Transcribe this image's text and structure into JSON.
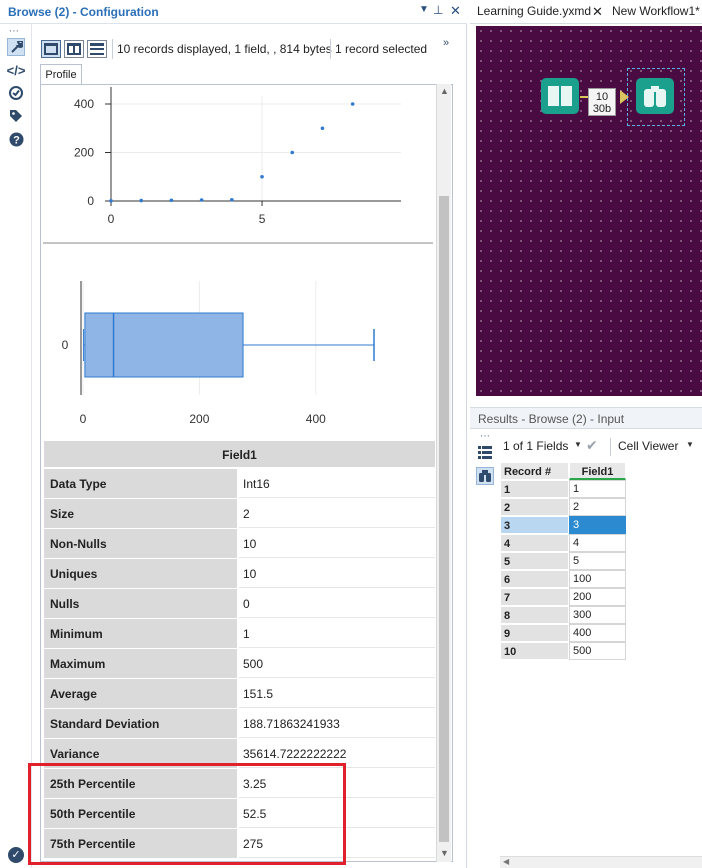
{
  "config_panel": {
    "title": "Browse (2) - Configuration",
    "status_records": "10 records displayed, 1 field, , 814 bytes",
    "status_selected": "1 record selected",
    "tab_profile": "Profile"
  },
  "colors": {
    "accent": "#2a6fb8",
    "box_fill": "#8fb5e6",
    "box_stroke": "#2f7ad0",
    "point": "#2f7ad0",
    "canvas_bg": "#4a0a42",
    "tool_teal": "#1aa08c",
    "highlight_red": "#e0202a",
    "selected_cell": "#2b8ad0"
  },
  "icons": {
    "sidebar": [
      "wrench-icon",
      "code-icon",
      "target-icon",
      "tag-icon",
      "help-icon"
    ],
    "toolbar": [
      "layout-single-icon",
      "layout-split-vertical-icon",
      "layout-split-horizontal-icon"
    ],
    "results": [
      "list-icon",
      "binoculars-icon"
    ]
  },
  "chart_data": [
    {
      "type": "scatter",
      "x": [
        0,
        1,
        2,
        3,
        4,
        5,
        6,
        7,
        8
      ],
      "y": [
        1,
        2,
        3,
        4,
        5,
        100,
        200,
        300,
        400
      ],
      "xticks": [
        "0",
        "5"
      ],
      "yticks": [
        "0",
        "200",
        "400"
      ],
      "xlim": [
        0,
        9.6
      ],
      "ylim": [
        0,
        400
      ],
      "grid": true
    },
    {
      "type": "box",
      "category": "0",
      "min": 1,
      "q1": 3.25,
      "median": 52.5,
      "q3": 275,
      "max": 500,
      "xticks": [
        "0",
        "200",
        "400"
      ],
      "xlim": [
        0,
        500
      ],
      "grid": true
    }
  ],
  "profile": {
    "header": "Field1",
    "rows": [
      {
        "k": "Data Type",
        "v": "Int16"
      },
      {
        "k": "Size",
        "v": "2"
      },
      {
        "k": "Non-Nulls",
        "v": "10"
      },
      {
        "k": "Uniques",
        "v": "10"
      },
      {
        "k": "Nulls",
        "v": "0"
      },
      {
        "k": "Minimum",
        "v": "1"
      },
      {
        "k": "Maximum",
        "v": "500"
      },
      {
        "k": "Average",
        "v": "151.5"
      },
      {
        "k": "Standard Deviation",
        "v": "188.71863241933"
      },
      {
        "k": "Variance",
        "v": "35614.7222222222"
      },
      {
        "k": "25th Percentile",
        "v": "3.25"
      },
      {
        "k": "50th Percentile",
        "v": "52.5"
      },
      {
        "k": "75th Percentile",
        "v": "275"
      }
    ]
  },
  "canvas_tabs": {
    "tab1": "Learning Guide.yxmd",
    "tab2": "New Workflow1*"
  },
  "workflow": {
    "connector_label_top": "10",
    "connector_label_bottom": "30b"
  },
  "results": {
    "title": "Results - Browse (2) - Input",
    "fields_selector": "1 of 1 Fields",
    "viewer": "Cell Viewer",
    "col_record": "Record #",
    "col_field": "Field1",
    "rows": [
      {
        "n": "1",
        "v": "1"
      },
      {
        "n": "2",
        "v": "2"
      },
      {
        "n": "3",
        "v": "3"
      },
      {
        "n": "4",
        "v": "4"
      },
      {
        "n": "5",
        "v": "5"
      },
      {
        "n": "6",
        "v": "100"
      },
      {
        "n": "7",
        "v": "200"
      },
      {
        "n": "8",
        "v": "300"
      },
      {
        "n": "9",
        "v": "400"
      },
      {
        "n": "10",
        "v": "500"
      }
    ],
    "selected_row": 2
  }
}
